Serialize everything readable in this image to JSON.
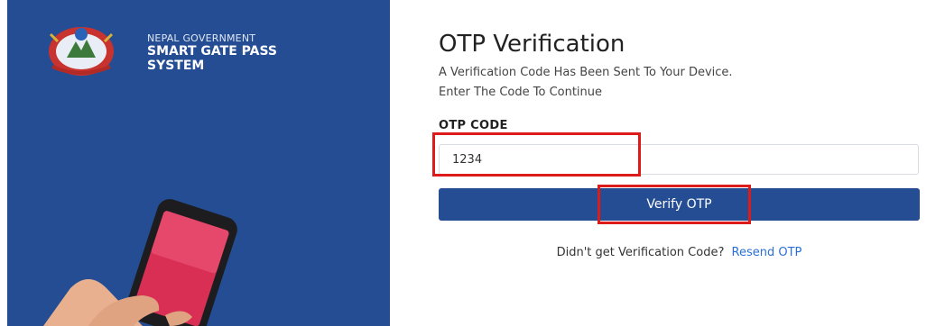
{
  "brand": {
    "subtitle": "NEPAL GOVERNMENT",
    "title_line1": "SMART GATE PASS",
    "title_line2": "SYSTEM"
  },
  "form": {
    "heading": "OTP Verification",
    "description_line1": "A Verification Code Has Been Sent To Your Device.",
    "description_line2": "Enter The Code To Continue",
    "otp_label": "OTP CODE",
    "otp_value": "1234",
    "verify_button": "Verify OTP",
    "resend_prompt": "Didn't get Verification Code?",
    "resend_link": "Resend OTP"
  },
  "colors": {
    "panel_blue": "#244d93",
    "highlight_red": "#dd1b1b",
    "link_blue": "#2b6fd6"
  },
  "icons": {
    "emblem": "nepal-emblem-icon",
    "phone": "phone-in-hand-illustration"
  }
}
